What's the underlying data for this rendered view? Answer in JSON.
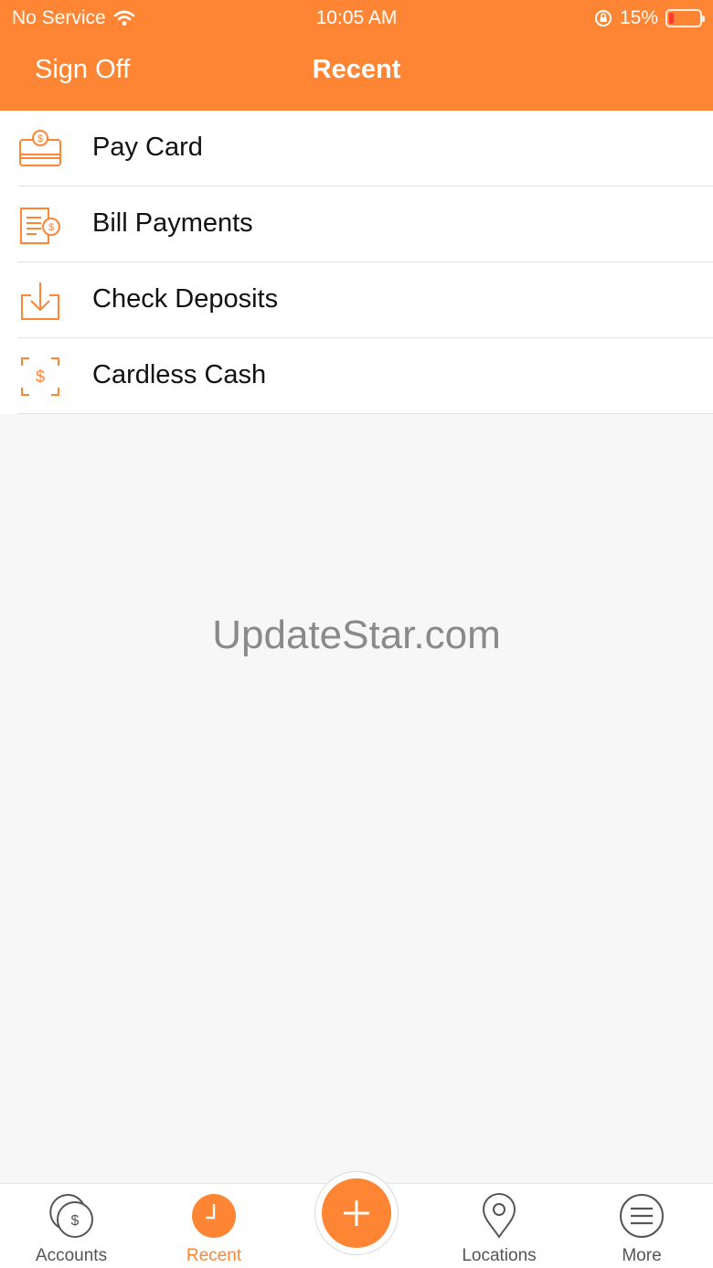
{
  "status_bar": {
    "carrier": "No Service",
    "time": "10:05 AM",
    "battery_text": "15%",
    "battery_level": 0.15
  },
  "nav": {
    "left_button": "Sign Off",
    "title": "Recent"
  },
  "list": {
    "items": [
      {
        "label": "Pay Card",
        "icon": "pay-card-icon"
      },
      {
        "label": "Bill Payments",
        "icon": "bill-payments-icon"
      },
      {
        "label": "Check Deposits",
        "icon": "check-deposits-icon"
      },
      {
        "label": "Cardless Cash",
        "icon": "cardless-cash-icon"
      }
    ]
  },
  "watermark": "UpdateStar.com",
  "tabbar": {
    "tabs": [
      {
        "label": "Accounts",
        "icon": "accounts-icon"
      },
      {
        "label": "Recent",
        "icon": "recent-clock-icon",
        "active": true
      },
      {
        "label": "",
        "icon": "add-plus-icon"
      },
      {
        "label": "Locations",
        "icon": "location-pin-icon"
      },
      {
        "label": "More",
        "icon": "menu-lines-icon"
      }
    ]
  },
  "colors": {
    "accent": "#fe8533",
    "background": "#f7f7f7"
  }
}
